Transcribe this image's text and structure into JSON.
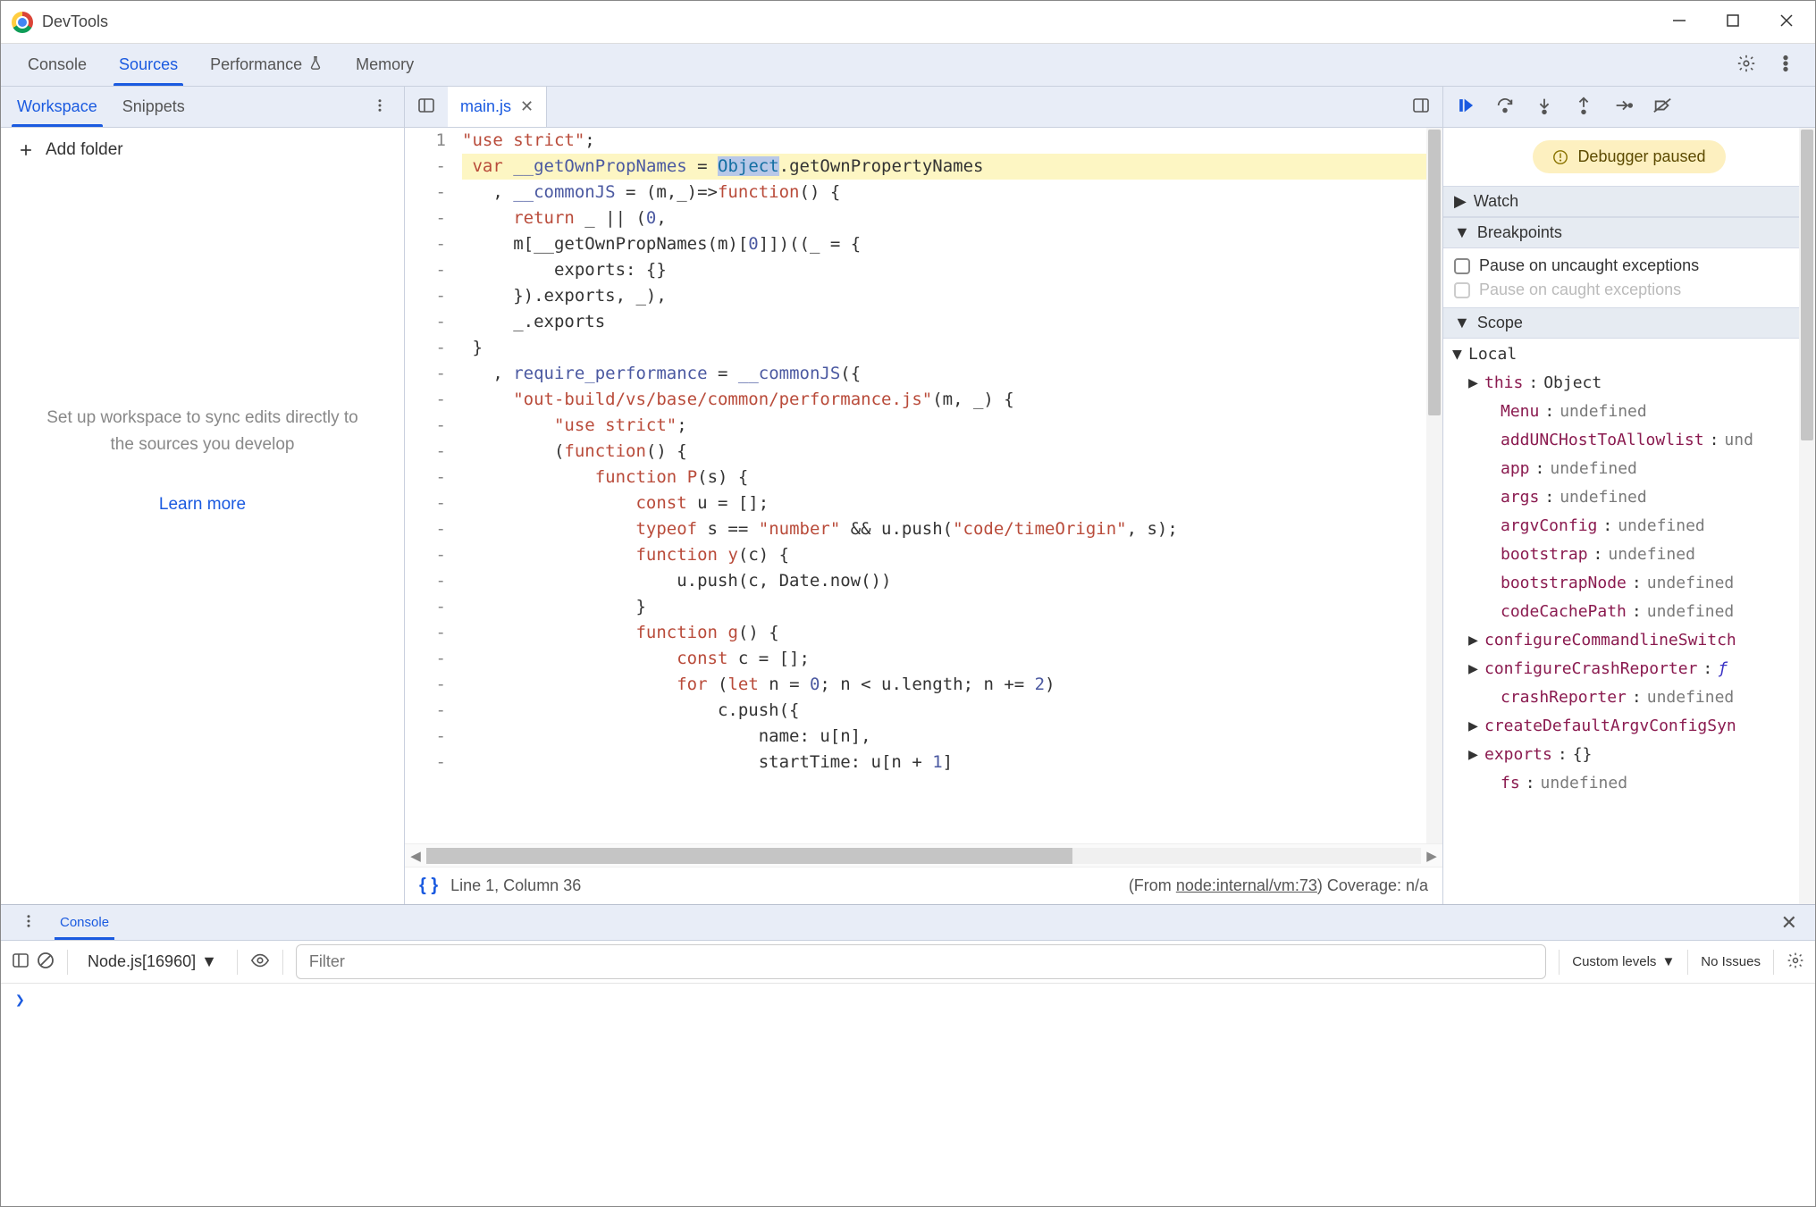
{
  "window": {
    "title": "DevTools"
  },
  "topTabs": {
    "console": "Console",
    "sources": "Sources",
    "performance": "Performance",
    "memory": "Memory"
  },
  "leftTabs": {
    "workspace": "Workspace",
    "snippets": "Snippets"
  },
  "addFolder": "Add folder",
  "workspaceMsg": {
    "line": "Set up workspace to sync edits directly to the sources you develop",
    "learnMore": "Learn more"
  },
  "fileTab": {
    "name": "main.js"
  },
  "code": {
    "lines": [
      {
        "num": "1",
        "html": "<span class='tok-str'>\"use strict\"</span>;"
      },
      {
        "num": "-",
        "hl": true,
        "html": " <span class='tok-kw'>var</span> <span class='tok-prop'>__getOwnPropNames</span> = <span class='tok-obj sel'>Object</span>.getOwnPropertyNames"
      },
      {
        "num": "-",
        "html": "   , <span class='tok-prop'>__commonJS</span> = (m,_)=&gt;<span class='tok-kw'>function</span>() {"
      },
      {
        "num": "-",
        "html": "     <span class='tok-kw'>return</span> _ || (<span class='tok-num'>0</span>,"
      },
      {
        "num": "-",
        "html": "     m[__getOwnPropNames(m)[<span class='tok-num'>0</span>]])((_ = {"
      },
      {
        "num": "-",
        "html": "         exports: {}"
      },
      {
        "num": "-",
        "html": "     }).exports, _),"
      },
      {
        "num": "-",
        "html": "     _.exports"
      },
      {
        "num": "-",
        "html": " }"
      },
      {
        "num": "-",
        "html": "   , <span class='tok-prop'>require_performance</span> = <span class='tok-prop'>__commonJS</span>({"
      },
      {
        "num": "-",
        "html": "     <span class='tok-str'>\"out-build/vs/base/common/performance.js\"</span>(m, _) {"
      },
      {
        "num": "-",
        "html": "         <span class='tok-str'>\"use strict\"</span>;"
      },
      {
        "num": "-",
        "html": "         (<span class='tok-kw'>function</span>() {"
      },
      {
        "num": "-",
        "html": "             <span class='tok-kw'>function</span> <span class='tok-fn'>P</span>(s) {"
      },
      {
        "num": "-",
        "html": "                 <span class='tok-kw'>const</span> u = [];"
      },
      {
        "num": "-",
        "html": "                 <span class='tok-kw'>typeof</span> s == <span class='tok-str'>\"number\"</span> &amp;&amp; u.push(<span class='tok-str'>\"code/timeOrigin\"</span>, s);"
      },
      {
        "num": "-",
        "html": "                 <span class='tok-kw'>function</span> <span class='tok-fn'>y</span>(c) {"
      },
      {
        "num": "-",
        "html": "                     u.push(c, Date.now())"
      },
      {
        "num": "-",
        "html": "                 }"
      },
      {
        "num": "-",
        "html": "                 <span class='tok-kw'>function</span> <span class='tok-fn'>g</span>() {"
      },
      {
        "num": "-",
        "html": "                     <span class='tok-kw'>const</span> c = [];"
      },
      {
        "num": "-",
        "html": "                     <span class='tok-kw'>for</span> (<span class='tok-kw'>let</span> n = <span class='tok-num'>0</span>; n &lt; u.length; n += <span class='tok-num'>2</span>)"
      },
      {
        "num": "-",
        "html": "                         c.push({"
      },
      {
        "num": "-",
        "html": "                             name: u[n],"
      },
      {
        "num": "-",
        "html": "                             startTime: u[n + <span class='tok-num'>1</span>]"
      }
    ]
  },
  "statusRow": {
    "cursor": "Line 1, Column 36",
    "from": "(From ",
    "link": "node:internal/vm:73",
    "coverage": ") Coverage: n/a"
  },
  "debugger": {
    "pausedLabel": "Debugger paused",
    "sections": {
      "watch": "Watch",
      "breakpoints": "Breakpoints",
      "scope": "Scope"
    },
    "breakpoints": {
      "uncaught": "Pause on uncaught exceptions",
      "caught": "Pause on caught exceptions"
    },
    "scope": {
      "local": "Local",
      "vars": [
        {
          "name": "this",
          "val": "Object",
          "tri": "▶",
          "valClass": "obj"
        },
        {
          "name": "Menu",
          "val": "undefined",
          "indent": 2
        },
        {
          "name": "addUNCHostToAllowlist",
          "val": "und",
          "indent": 2
        },
        {
          "name": "app",
          "val": "undefined",
          "indent": 2
        },
        {
          "name": "args",
          "val": "undefined",
          "indent": 2
        },
        {
          "name": "argvConfig",
          "val": "undefined",
          "indent": 2
        },
        {
          "name": "bootstrap",
          "val": "undefined",
          "indent": 2
        },
        {
          "name": "bootstrapNode",
          "val": "undefined",
          "indent": 2
        },
        {
          "name": "codeCachePath",
          "val": "undefined",
          "indent": 2
        },
        {
          "name": "configureCommandlineSwitch",
          "tri": "▶",
          "indent": 1
        },
        {
          "name": "configureCrashReporter",
          "val": "ƒ",
          "tri": "▶",
          "indent": 1,
          "valClass": "scope-fn"
        },
        {
          "name": "crashReporter",
          "val": "undefined",
          "indent": 2
        },
        {
          "name": "createDefaultArgvConfigSyn",
          "tri": "▶",
          "indent": 1
        },
        {
          "name": "exports",
          "val": "{}",
          "tri": "▶",
          "indent": 1,
          "valClass": "obj"
        },
        {
          "name": "fs",
          "val": "undefined",
          "indent": 2
        }
      ]
    }
  },
  "drawer": {
    "tab": "Console",
    "context": "Node.js[16960]",
    "filterPlaceholder": "Filter",
    "levels": "Custom levels",
    "issues": "No Issues",
    "prompt": "❯"
  }
}
